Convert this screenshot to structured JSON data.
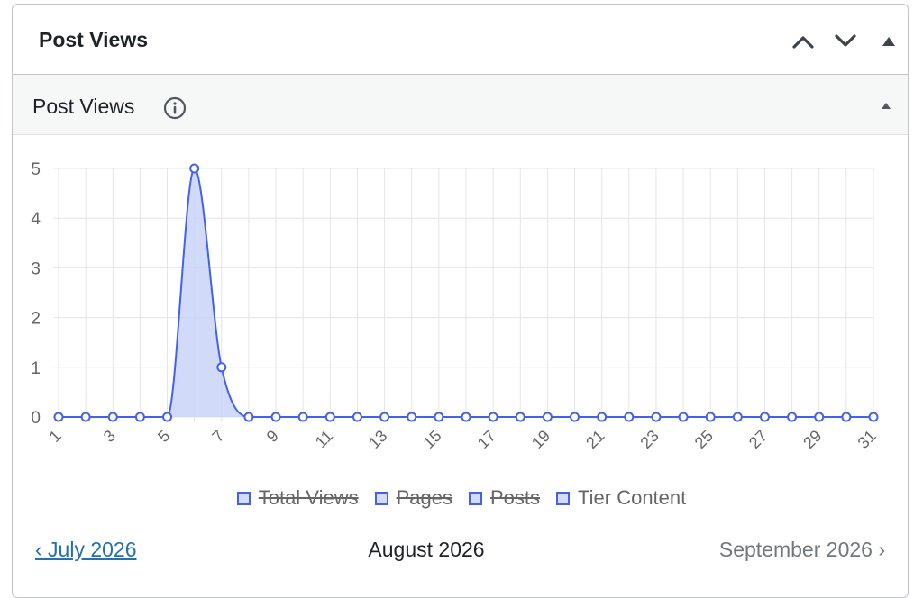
{
  "widget": {
    "title": "Post Views",
    "controls": [
      "chevron-up-icon",
      "chevron-down-icon",
      "triangle-up-icon"
    ]
  },
  "panel": {
    "title": "Post Views",
    "info_icon": "info-icon",
    "toggle_icon": "triangle-up-icon"
  },
  "colors": {
    "series": "#4361ee",
    "fill": "#c9d3f8",
    "grid": "#e5e5e5",
    "link": "#2271b1",
    "muted": "#72777c"
  },
  "chart_data": {
    "type": "area",
    "x": [
      1,
      2,
      3,
      4,
      5,
      6,
      7,
      8,
      9,
      10,
      11,
      12,
      13,
      14,
      15,
      16,
      17,
      18,
      19,
      20,
      21,
      22,
      23,
      24,
      25,
      26,
      27,
      28,
      29,
      30,
      31
    ],
    "x_tick_labels": [
      "1",
      "3",
      "5",
      "7",
      "9",
      "11",
      "13",
      "15",
      "17",
      "19",
      "21",
      "23",
      "25",
      "27",
      "29",
      "31"
    ],
    "y_tick_labels": [
      "0",
      "1",
      "2",
      "3",
      "4",
      "5"
    ],
    "ylim": [
      0,
      5
    ],
    "grid": true,
    "legend_position": "bottom",
    "series": [
      {
        "name": "Tier Content",
        "values": [
          0,
          0,
          0,
          0,
          0,
          5,
          1,
          0,
          0,
          0,
          0,
          0,
          0,
          0,
          0,
          0,
          0,
          0,
          0,
          0,
          0,
          0,
          0,
          0,
          0,
          0,
          0,
          0,
          0,
          0,
          0
        ]
      }
    ],
    "legend": [
      {
        "label": "Total Views",
        "hidden": true
      },
      {
        "label": "Pages",
        "hidden": true
      },
      {
        "label": "Posts",
        "hidden": true
      },
      {
        "label": "Tier Content",
        "hidden": false
      }
    ]
  },
  "nav": {
    "prev": "‹ July 2026",
    "current": "August 2026",
    "next": "September 2026 ›"
  }
}
